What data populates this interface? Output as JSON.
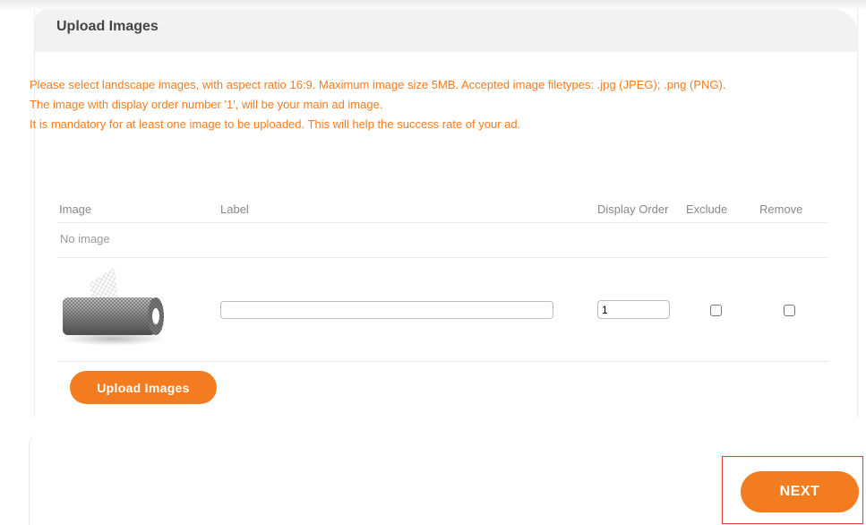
{
  "panel": {
    "title": "Upload Images",
    "notices": [
      "Please select landscape images, with aspect ratio 16:9. Maximum image size 5MB. Accepted image filetypes: .jpg (JPEG); .png (PNG).",
      "The image with display order number '1', will be your main ad image.",
      "It is mandatory for at least one image to be uploaded. This will help the success rate of your ad."
    ],
    "notice_color": "#f47c20"
  },
  "table": {
    "headers": {
      "image": "Image",
      "label": "Label",
      "display_order": "Display Order",
      "exclude": "Exclude",
      "remove": "Remove"
    },
    "empty_text": "No image",
    "rows": [
      {
        "thumbnail": "wire-mesh-roll-image",
        "label_value": "",
        "display_order": "1",
        "exclude": false,
        "remove": false
      }
    ]
  },
  "buttons": {
    "upload": "Upload Images",
    "next": "NEXT"
  },
  "colors": {
    "accent": "#f47c20",
    "highlight": "#e23b3b"
  }
}
